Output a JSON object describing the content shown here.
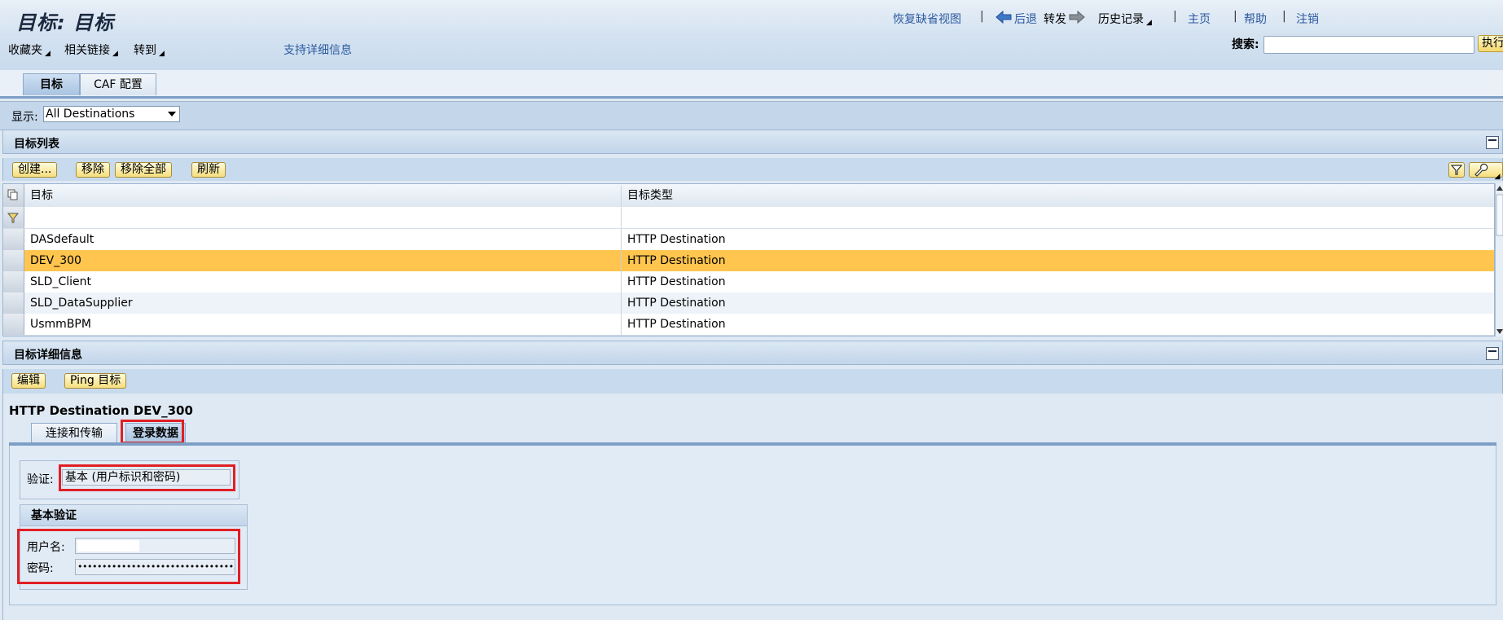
{
  "header": {
    "title": "目标: 目标",
    "restore_default_view": "恢复缺省视图",
    "back": "后退",
    "forward": "转发",
    "history": "历史记录",
    "home": "主页",
    "help": "帮助",
    "logout": "注销",
    "sep": "|",
    "search_label": "搜索:",
    "search_value": "",
    "execute": "执行"
  },
  "menubar": {
    "favorites": "收藏夹",
    "related_links": "相关链接",
    "goto": "转到",
    "support_details": "支持详细信息"
  },
  "tabs": {
    "target": "目标",
    "caf": "CAF 配置"
  },
  "filter": {
    "label": "显示:",
    "selected": "All Destinations"
  },
  "list_panel": {
    "title": "目标列表",
    "buttons": {
      "create": "创建...",
      "remove": "移除",
      "remove_all": "移除全部",
      "refresh": "刷新"
    },
    "columns": {
      "target": "目标",
      "type": "目标类型"
    },
    "rows": [
      {
        "name": "DASdefault",
        "type": "HTTP Destination"
      },
      {
        "name": "DEV_300",
        "type": "HTTP Destination"
      },
      {
        "name": "SLD_Client",
        "type": "HTTP Destination"
      },
      {
        "name": "SLD_DataSupplier",
        "type": "HTTP Destination"
      },
      {
        "name": "UsmmBPM",
        "type": "HTTP Destination"
      }
    ],
    "selected_row": 1
  },
  "detail_panel": {
    "title": "目标详细信息",
    "buttons": {
      "edit": "编辑",
      "ping": "Ping 目标"
    },
    "heading": "HTTP Destination DEV_300",
    "tabs": {
      "connection": "连接和传输",
      "login": "登录数据"
    },
    "auth_label": "验证:",
    "auth_value": "基本 (用户标识和密码)",
    "basic_auth_title": "基本验证",
    "username_label": "用户名:",
    "username_value": "",
    "password_label": "密码:",
    "password_value": "••••••••••••••••••••••••••••••••..."
  },
  "colors": {
    "selected_row": "#ffc54f",
    "highlight": "#e01f26",
    "accent": "#2c5aa0"
  }
}
